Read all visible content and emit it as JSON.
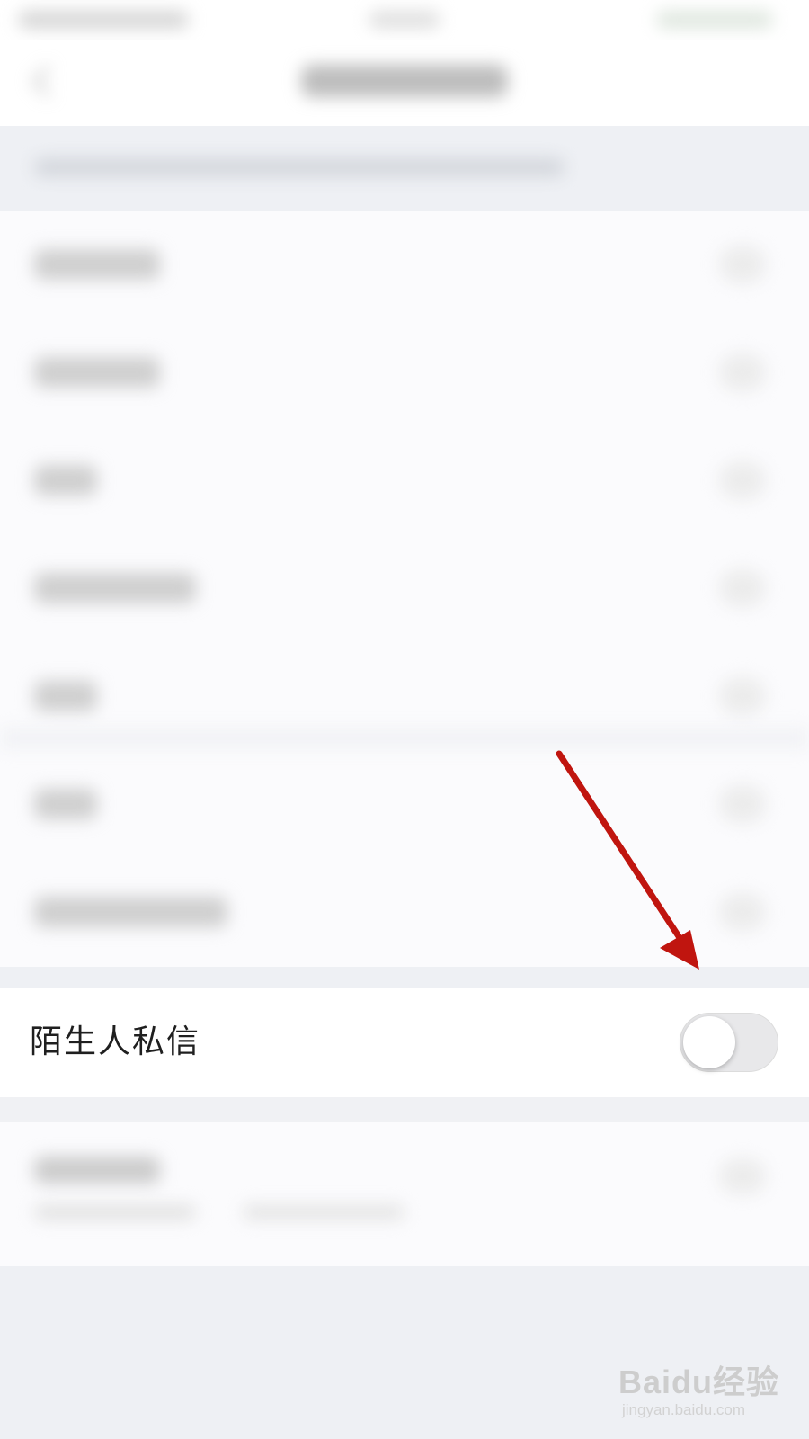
{
  "setting_row": {
    "label": "陌生人私信",
    "toggle": {
      "state": "off"
    }
  },
  "watermark": {
    "main": "Baidu经验",
    "sub": "jingyan.baidu.com"
  },
  "colors": {
    "background": "#eef0f4",
    "row_background": "#ffffff",
    "label": "#1f1f1f",
    "toggle_off": "#e8e8ea",
    "annotation_arrow": "#c0150f"
  },
  "icons": {
    "back": "chevron-left-icon",
    "annotation": "red-arrow-annotation"
  }
}
